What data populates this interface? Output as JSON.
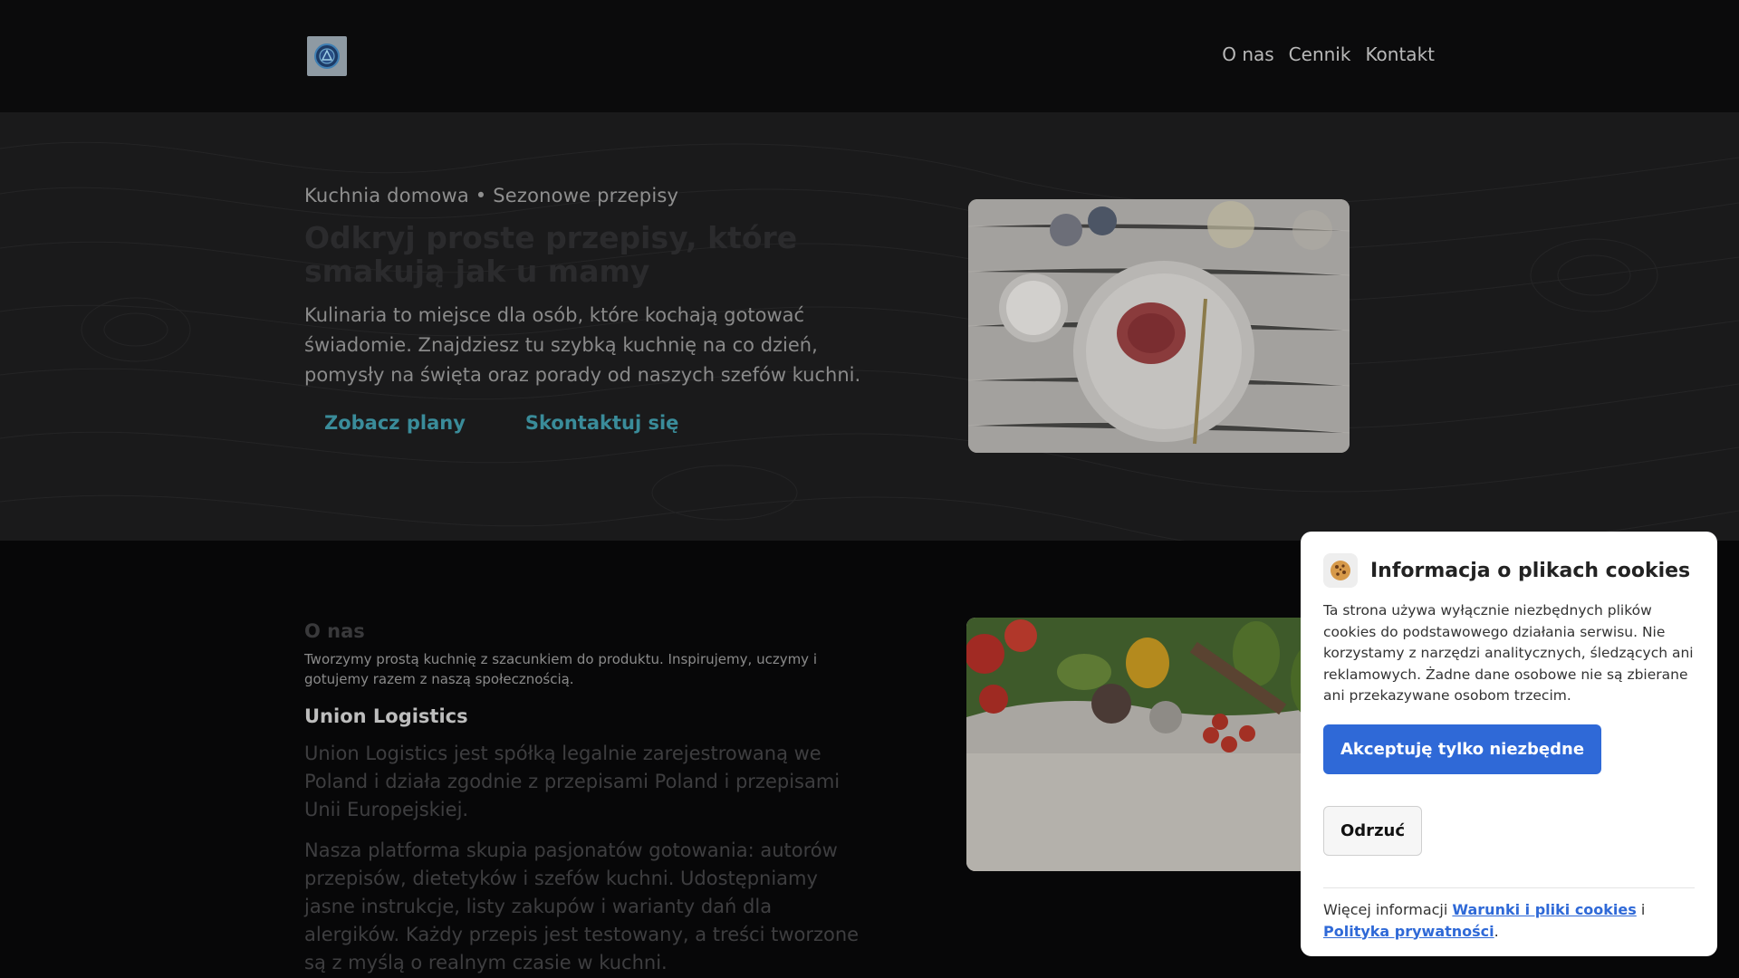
{
  "header": {
    "nav": [
      "O nas",
      "Cennik",
      "Kontakt"
    ]
  },
  "hero": {
    "eyebrow": "Kuchnia domowa • Sezonowe przepisy",
    "title": "Odkryj proste przepisy, które smakują jak u mamy",
    "description": "Kulinaria to miejsce dla osób, które kochają gotować świadomie. Znajdziesz tu szybką kuchnię na co dzień, pomysły na święta oraz porady od naszych szefów kuchni.",
    "primary_button": "Zobacz plany",
    "secondary_button": "Skontaktuj się"
  },
  "about": {
    "heading": "O nas",
    "lead": "Tworzymy prostą kuchnię z szacunkiem do produktu. Inspirujemy, uczymy i gotujemy razem z naszą społecznością.",
    "company_name": "Union Logistics",
    "paragraph1": "Union Logistics jest spółką legalnie zarejestrowaną we Poland i działa zgodnie z przepisami Poland i przepisami Unii Europejskiej.",
    "paragraph2": "Nasza platforma skupia pasjonatów gotowania: autorów przepisów, dietetyków i szefów kuchni. Udostępniamy jasne instrukcje, listy zakupów i warianty dań dla alergików. Każdy przepis jest testowany, a treści tworzone są z myślą o realnym czasie w kuchni."
  },
  "cookie": {
    "icon": "cookie-icon",
    "title": "Informacja o plikach cookies",
    "body": "Ta strona używa wyłącznie niezbędnych plików cookies do podstawowego działania serwisu. Nie korzystamy z narzędzi analitycznych, śledzących ani reklamowych. Żadne dane osobowe nie są zbierane ani przekazywane osobom trzecim.",
    "accept_button": "Akceptuję tylko niezbędne",
    "reject_button": "Odrzuć",
    "more_info": "Więcej informacji",
    "terms_link": "Warunki i pliki cookies",
    "and_text": "i",
    "privacy_link": "Polityka prywatności",
    "period": "."
  },
  "colors": {
    "accent_link": "#3a8c9a",
    "accept_button": "#2f69d7"
  }
}
